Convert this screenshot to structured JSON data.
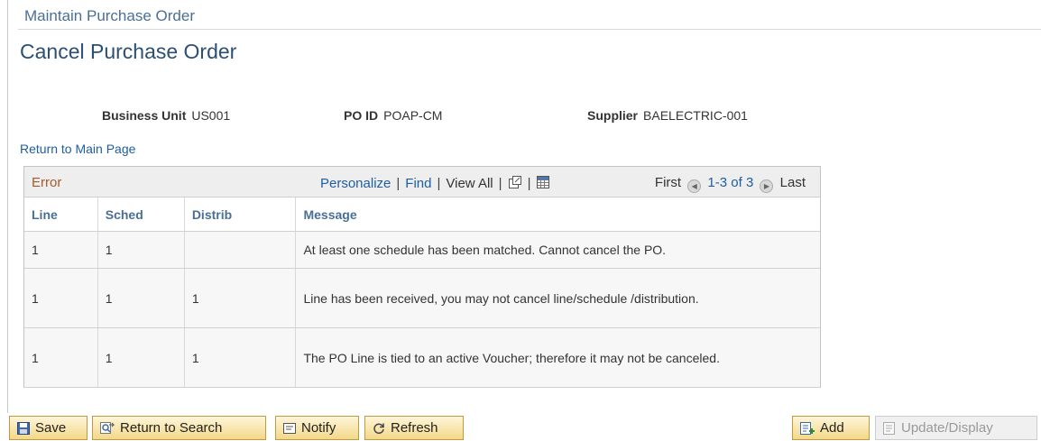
{
  "breadcrumb": "Maintain Purchase Order",
  "page_title": "Cancel Purchase Order",
  "header": {
    "business_unit_label": "Business Unit",
    "business_unit_value": "US001",
    "po_id_label": "PO ID",
    "po_id_value": "POAP-CM",
    "supplier_label": "Supplier",
    "supplier_value": "BAELECTRIC-001"
  },
  "return_link": "Return to Main Page",
  "grid": {
    "title": "Error",
    "personalize": "Personalize",
    "find": "Find",
    "view_all": "View All",
    "first": "First",
    "range": "1-3 of 3",
    "last": "Last",
    "columns": [
      "Line",
      "Sched",
      "Distrib",
      "Message"
    ],
    "rows": [
      {
        "line": "1",
        "sched": "1",
        "distrib": "",
        "message": "At least one schedule has been matched.  Cannot cancel the PO."
      },
      {
        "line": "1",
        "sched": "1",
        "distrib": "1",
        "message": "Line has been received, you may not cancel line/schedule /distribution."
      },
      {
        "line": "1",
        "sched": "1",
        "distrib": "1",
        "message": "The PO Line is tied to an active Voucher; therefore it may not be canceled."
      }
    ]
  },
  "toolbar": {
    "save": "Save",
    "return_to_search": "Return to Search",
    "notify": "Notify",
    "refresh": "Refresh",
    "add": "Add",
    "update_display": "Update/Display"
  }
}
